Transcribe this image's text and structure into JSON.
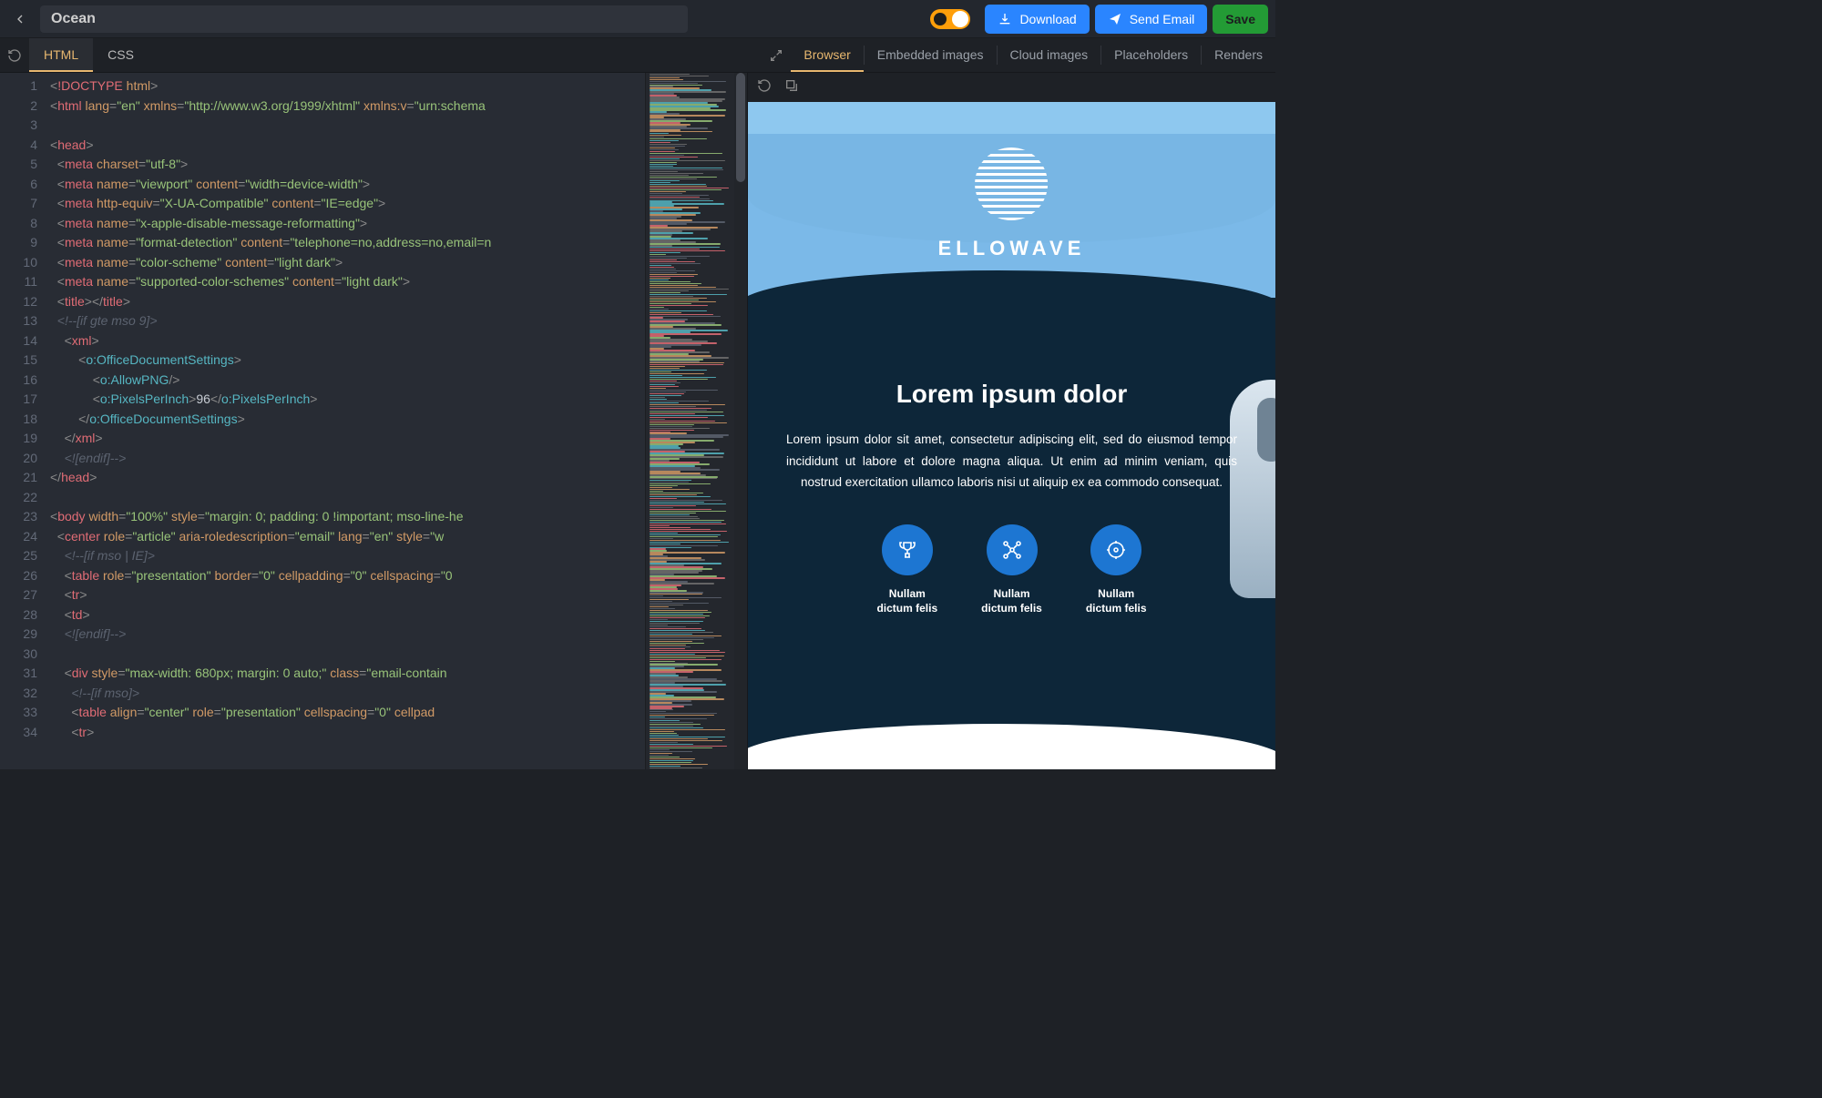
{
  "header": {
    "project_name": "Ocean",
    "buttons": {
      "download": "Download",
      "send": "Send Email",
      "save": "Save"
    }
  },
  "left_tabs": [
    "HTML",
    "CSS"
  ],
  "left_active_tab": 0,
  "right_tabs": [
    "Browser",
    "Embedded images",
    "Cloud images",
    "Placeholders",
    "Renders"
  ],
  "right_active_tab": 0,
  "code_lines": [
    {
      "n": 1,
      "seg": [
        [
          "p",
          "<"
        ],
        [
          "t",
          "!DOCTYPE"
        ],
        [
          "",
          ""
        ],
        [
          "",
          " "
        ],
        [
          "a",
          "html"
        ],
        [
          "p",
          ">"
        ]
      ]
    },
    {
      "n": 2,
      "seg": [
        [
          "p",
          "<"
        ],
        [
          "t",
          "html"
        ],
        [
          "",
          " "
        ],
        [
          "a",
          "lang"
        ],
        [
          "p",
          "="
        ],
        [
          "s",
          "\"en\""
        ],
        [
          "",
          " "
        ],
        [
          "a",
          "xmlns"
        ],
        [
          "p",
          "="
        ],
        [
          "s",
          "\"http://www.w3.org/1999/xhtml\""
        ],
        [
          "",
          " "
        ],
        [
          "a",
          "xmlns:v"
        ],
        [
          "p",
          "="
        ],
        [
          "s",
          "\"urn:schema"
        ]
      ]
    },
    {
      "n": 3,
      "seg": []
    },
    {
      "n": 4,
      "seg": [
        [
          "p",
          "<"
        ],
        [
          "t",
          "head"
        ],
        [
          "p",
          ">"
        ]
      ]
    },
    {
      "n": 5,
      "seg": [
        [
          "",
          "  "
        ],
        [
          "p",
          "<"
        ],
        [
          "t",
          "meta"
        ],
        [
          "",
          " "
        ],
        [
          "a",
          "charset"
        ],
        [
          "p",
          "="
        ],
        [
          "s",
          "\"utf-8\""
        ],
        [
          "p",
          ">"
        ]
      ]
    },
    {
      "n": 6,
      "seg": [
        [
          "",
          "  "
        ],
        [
          "p",
          "<"
        ],
        [
          "t",
          "meta"
        ],
        [
          "",
          " "
        ],
        [
          "a",
          "name"
        ],
        [
          "p",
          "="
        ],
        [
          "s",
          "\"viewport\""
        ],
        [
          "",
          " "
        ],
        [
          "a",
          "content"
        ],
        [
          "p",
          "="
        ],
        [
          "s",
          "\"width=device-width\""
        ],
        [
          "p",
          ">"
        ]
      ]
    },
    {
      "n": 7,
      "seg": [
        [
          "",
          "  "
        ],
        [
          "p",
          "<"
        ],
        [
          "t",
          "meta"
        ],
        [
          "",
          " "
        ],
        [
          "a",
          "http-equiv"
        ],
        [
          "p",
          "="
        ],
        [
          "s",
          "\"X-UA-Compatible\""
        ],
        [
          "",
          " "
        ],
        [
          "a",
          "content"
        ],
        [
          "p",
          "="
        ],
        [
          "s",
          "\"IE=edge\""
        ],
        [
          "p",
          ">"
        ]
      ]
    },
    {
      "n": 8,
      "seg": [
        [
          "",
          "  "
        ],
        [
          "p",
          "<"
        ],
        [
          "t",
          "meta"
        ],
        [
          "",
          " "
        ],
        [
          "a",
          "name"
        ],
        [
          "p",
          "="
        ],
        [
          "s",
          "\"x-apple-disable-message-reformatting\""
        ],
        [
          "p",
          ">"
        ]
      ]
    },
    {
      "n": 9,
      "seg": [
        [
          "",
          "  "
        ],
        [
          "p",
          "<"
        ],
        [
          "t",
          "meta"
        ],
        [
          "",
          " "
        ],
        [
          "a",
          "name"
        ],
        [
          "p",
          "="
        ],
        [
          "s",
          "\"format-detection\""
        ],
        [
          "",
          " "
        ],
        [
          "a",
          "content"
        ],
        [
          "p",
          "="
        ],
        [
          "s",
          "\"telephone=no,address=no,email=n"
        ]
      ]
    },
    {
      "n": 10,
      "seg": [
        [
          "",
          "  "
        ],
        [
          "p",
          "<"
        ],
        [
          "t",
          "meta"
        ],
        [
          "",
          " "
        ],
        [
          "a",
          "name"
        ],
        [
          "p",
          "="
        ],
        [
          "s",
          "\"color-scheme\""
        ],
        [
          "",
          " "
        ],
        [
          "a",
          "content"
        ],
        [
          "p",
          "="
        ],
        [
          "s",
          "\"light dark\""
        ],
        [
          "p",
          ">"
        ]
      ]
    },
    {
      "n": 11,
      "seg": [
        [
          "",
          "  "
        ],
        [
          "p",
          "<"
        ],
        [
          "t",
          "meta"
        ],
        [
          "",
          " "
        ],
        [
          "a",
          "name"
        ],
        [
          "p",
          "="
        ],
        [
          "s",
          "\"supported-color-schemes\""
        ],
        [
          "",
          " "
        ],
        [
          "a",
          "content"
        ],
        [
          "p",
          "="
        ],
        [
          "s",
          "\"light dark\""
        ],
        [
          "p",
          ">"
        ]
      ]
    },
    {
      "n": 12,
      "seg": [
        [
          "",
          "  "
        ],
        [
          "p",
          "<"
        ],
        [
          "t",
          "title"
        ],
        [
          "p",
          "></"
        ],
        [
          "t",
          "title"
        ],
        [
          "p",
          ">"
        ]
      ]
    },
    {
      "n": 13,
      "seg": [
        [
          "",
          "  "
        ],
        [
          "c",
          "<!--[if gte mso 9]>"
        ]
      ]
    },
    {
      "n": 14,
      "seg": [
        [
          "",
          "    "
        ],
        [
          "p",
          "<"
        ],
        [
          "t",
          "xml"
        ],
        [
          "p",
          ">"
        ]
      ]
    },
    {
      "n": 15,
      "seg": [
        [
          "",
          "        "
        ],
        [
          "p",
          "<"
        ],
        [
          "e",
          "o:OfficeDocumentSettings"
        ],
        [
          "p",
          ">"
        ]
      ]
    },
    {
      "n": 16,
      "seg": [
        [
          "",
          "            "
        ],
        [
          "p",
          "<"
        ],
        [
          "e",
          "o:AllowPNG"
        ],
        [
          "p",
          "/>"
        ]
      ]
    },
    {
      "n": 17,
      "seg": [
        [
          "",
          "            "
        ],
        [
          "p",
          "<"
        ],
        [
          "e",
          "o:PixelsPerInch"
        ],
        [
          "p",
          ">"
        ],
        [
          "",
          "96"
        ],
        [
          "p",
          "</"
        ],
        [
          "e",
          "o:PixelsPerInch"
        ],
        [
          "p",
          ">"
        ]
      ]
    },
    {
      "n": 18,
      "seg": [
        [
          "",
          "        "
        ],
        [
          "p",
          "</"
        ],
        [
          "e",
          "o:OfficeDocumentSettings"
        ],
        [
          "p",
          ">"
        ]
      ]
    },
    {
      "n": 19,
      "seg": [
        [
          "",
          "    "
        ],
        [
          "p",
          "</"
        ],
        [
          "t",
          "xml"
        ],
        [
          "p",
          ">"
        ]
      ]
    },
    {
      "n": 20,
      "seg": [
        [
          "",
          "    "
        ],
        [
          "c",
          "<![endif]-->"
        ]
      ]
    },
    {
      "n": 21,
      "seg": [
        [
          "p",
          "</"
        ],
        [
          "t",
          "head"
        ],
        [
          "p",
          ">"
        ]
      ]
    },
    {
      "n": 22,
      "seg": []
    },
    {
      "n": 23,
      "seg": [
        [
          "p",
          "<"
        ],
        [
          "t",
          "body"
        ],
        [
          "",
          " "
        ],
        [
          "a",
          "width"
        ],
        [
          "p",
          "="
        ],
        [
          "s",
          "\"100%\""
        ],
        [
          "",
          " "
        ],
        [
          "a",
          "style"
        ],
        [
          "p",
          "="
        ],
        [
          "s",
          "\"margin: 0; padding: 0 !important; mso-line-he"
        ]
      ]
    },
    {
      "n": 24,
      "seg": [
        [
          "",
          "  "
        ],
        [
          "p",
          "<"
        ],
        [
          "t",
          "center"
        ],
        [
          "",
          " "
        ],
        [
          "a",
          "role"
        ],
        [
          "p",
          "="
        ],
        [
          "s",
          "\"article\""
        ],
        [
          "",
          " "
        ],
        [
          "a",
          "aria-roledescription"
        ],
        [
          "p",
          "="
        ],
        [
          "s",
          "\"email\""
        ],
        [
          "",
          " "
        ],
        [
          "a",
          "lang"
        ],
        [
          "p",
          "="
        ],
        [
          "s",
          "\"en\""
        ],
        [
          "",
          " "
        ],
        [
          "a",
          "style"
        ],
        [
          "p",
          "="
        ],
        [
          "s",
          "\"w"
        ]
      ]
    },
    {
      "n": 25,
      "seg": [
        [
          "",
          "    "
        ],
        [
          "c",
          "<!--[if mso | IE]>"
        ]
      ]
    },
    {
      "n": 26,
      "seg": [
        [
          "",
          "    "
        ],
        [
          "p",
          "<"
        ],
        [
          "t",
          "table"
        ],
        [
          "",
          " "
        ],
        [
          "a",
          "role"
        ],
        [
          "p",
          "="
        ],
        [
          "s",
          "\"presentation\""
        ],
        [
          "",
          " "
        ],
        [
          "a",
          "border"
        ],
        [
          "p",
          "="
        ],
        [
          "s",
          "\"0\""
        ],
        [
          "",
          " "
        ],
        [
          "a",
          "cellpadding"
        ],
        [
          "p",
          "="
        ],
        [
          "s",
          "\"0\""
        ],
        [
          "",
          " "
        ],
        [
          "a",
          "cellspacing"
        ],
        [
          "p",
          "="
        ],
        [
          "s",
          "\"0"
        ]
      ]
    },
    {
      "n": 27,
      "seg": [
        [
          "",
          "    "
        ],
        [
          "p",
          "<"
        ],
        [
          "t",
          "tr"
        ],
        [
          "p",
          ">"
        ]
      ]
    },
    {
      "n": 28,
      "seg": [
        [
          "",
          "    "
        ],
        [
          "p",
          "<"
        ],
        [
          "t",
          "td"
        ],
        [
          "p",
          ">"
        ]
      ]
    },
    {
      "n": 29,
      "seg": [
        [
          "",
          "    "
        ],
        [
          "c",
          "<![endif]-->"
        ]
      ]
    },
    {
      "n": 30,
      "seg": []
    },
    {
      "n": 31,
      "seg": [
        [
          "",
          "    "
        ],
        [
          "p",
          "<"
        ],
        [
          "t",
          "div"
        ],
        [
          "",
          " "
        ],
        [
          "a",
          "style"
        ],
        [
          "p",
          "="
        ],
        [
          "s",
          "\"max-width: 680px; margin: 0 auto;\""
        ],
        [
          "",
          " "
        ],
        [
          "a",
          "class"
        ],
        [
          "p",
          "="
        ],
        [
          "s",
          "\"email-contain"
        ]
      ]
    },
    {
      "n": 32,
      "seg": [
        [
          "",
          "      "
        ],
        [
          "c",
          "<!--[if mso]>"
        ]
      ]
    },
    {
      "n": 33,
      "seg": [
        [
          "",
          "      "
        ],
        [
          "p",
          "<"
        ],
        [
          "t",
          "table"
        ],
        [
          "",
          " "
        ],
        [
          "a",
          "align"
        ],
        [
          "p",
          "="
        ],
        [
          "s",
          "\"center\""
        ],
        [
          "",
          " "
        ],
        [
          "a",
          "role"
        ],
        [
          "p",
          "="
        ],
        [
          "s",
          "\"presentation\""
        ],
        [
          "",
          " "
        ],
        [
          "a",
          "cellspacing"
        ],
        [
          "p",
          "="
        ],
        [
          "s",
          "\"0\""
        ],
        [
          "",
          " "
        ],
        [
          "a",
          "cellpad"
        ]
      ]
    },
    {
      "n": 34,
      "seg": [
        [
          "",
          "      "
        ],
        [
          "p",
          "<"
        ],
        [
          "t",
          "tr"
        ],
        [
          "p",
          ">"
        ]
      ]
    }
  ],
  "preview": {
    "brand": "ELLOWAVE",
    "hero_title": "Lorem ipsum dolor",
    "hero_body": "Lorem ipsum dolor sit amet, consectetur adipiscing elit, sed do eiusmod tempor incididunt ut labore et dolore magna aliqua. Ut enim ad minim veniam, quis nostrud exercitation ullamco laboris nisi ut aliquip ex ea commodo consequat.",
    "features": [
      {
        "label": "Nullam\ndictum felis",
        "icon": "trophy"
      },
      {
        "label": "Nullam\ndictum felis",
        "icon": "network"
      },
      {
        "label": "Nullam\ndictum felis",
        "icon": "target"
      }
    ]
  }
}
